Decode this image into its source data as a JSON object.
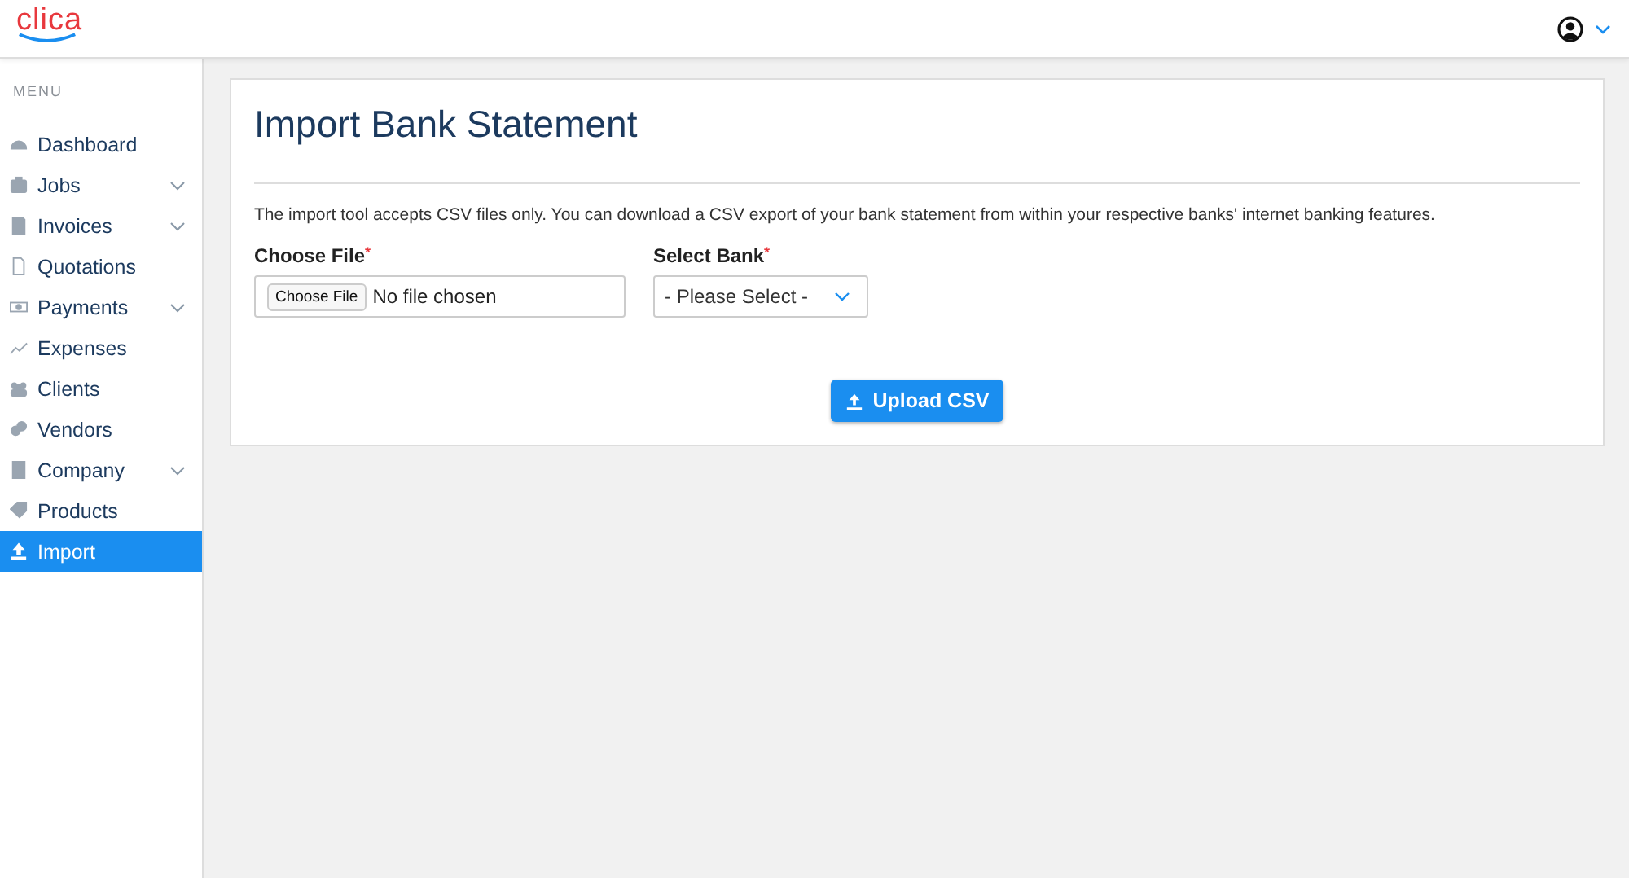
{
  "header": {
    "logo": "clica"
  },
  "sidebar": {
    "heading": "MENU",
    "items": [
      {
        "label": "Dashboard",
        "expandable": false,
        "selected": false
      },
      {
        "label": "Jobs",
        "expandable": true,
        "selected": false
      },
      {
        "label": "Invoices",
        "expandable": true,
        "selected": false
      },
      {
        "label": "Quotations",
        "expandable": false,
        "selected": false
      },
      {
        "label": "Payments",
        "expandable": true,
        "selected": false
      },
      {
        "label": "Expenses",
        "expandable": false,
        "selected": false
      },
      {
        "label": "Clients",
        "expandable": false,
        "selected": false
      },
      {
        "label": "Vendors",
        "expandable": false,
        "selected": false
      },
      {
        "label": "Company",
        "expandable": true,
        "selected": false
      },
      {
        "label": "Products",
        "expandable": false,
        "selected": false
      },
      {
        "label": "Import",
        "expandable": false,
        "selected": true
      }
    ]
  },
  "page": {
    "title": "Import Bank Statement",
    "description": "The import tool accepts CSV files only. You can download a CSV export of your bank statement from within your respective banks' internet banking features.",
    "file_field": {
      "label": "Choose File",
      "required_mark": "*",
      "button": "Choose File",
      "status": "No file chosen"
    },
    "bank_field": {
      "label": "Select Bank",
      "required_mark": "*",
      "value": "- Please Select -"
    },
    "upload_button": "Upload CSV"
  }
}
